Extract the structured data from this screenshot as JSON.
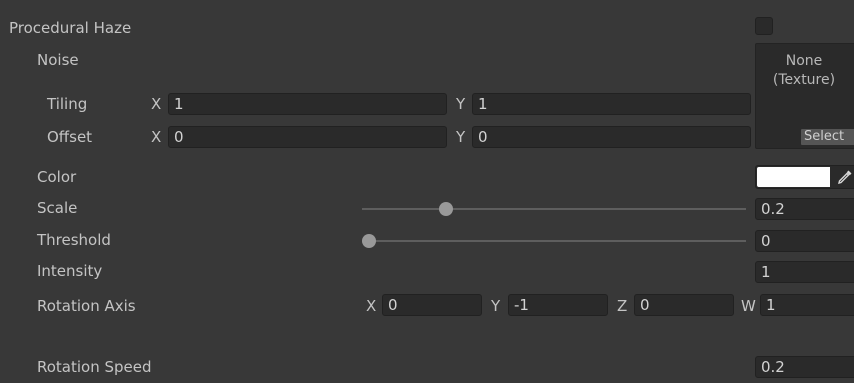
{
  "title": "Procedural Haze",
  "noise": {
    "label": "Noise",
    "texture_none": "None",
    "texture_type": "(Texture)",
    "select_label": "Select"
  },
  "tiling": {
    "label": "Tiling",
    "x_axis": "X",
    "x": "1",
    "y_axis": "Y",
    "y": "1"
  },
  "offset": {
    "label": "Offset",
    "x_axis": "X",
    "x": "0",
    "y_axis": "Y",
    "y": "0"
  },
  "color": {
    "label": "Color",
    "value": "#ffffff",
    "picker_icon": "eyedropper-icon"
  },
  "scale": {
    "label": "Scale",
    "value": "0.2",
    "slider_fraction": 0.2
  },
  "threshold": {
    "label": "Threshold",
    "value": "0",
    "slider_fraction": 0
  },
  "intensity": {
    "label": "Intensity",
    "value": "1"
  },
  "rotation_axis": {
    "label": "Rotation Axis",
    "x_axis": "X",
    "x": "0",
    "y_axis": "Y",
    "y": "-1",
    "z_axis": "Z",
    "z": "0",
    "w_axis": "W",
    "w": "1"
  },
  "rotation_speed": {
    "label": "Rotation Speed",
    "value": "0.2"
  }
}
